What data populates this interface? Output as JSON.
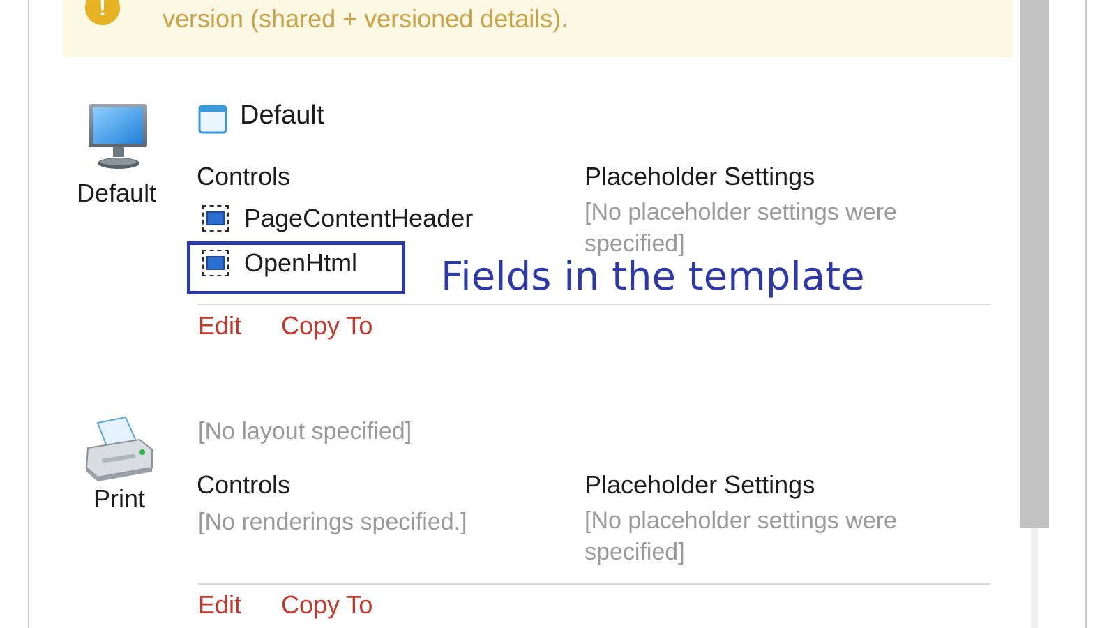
{
  "warning": {
    "icon": "exclamation-icon",
    "icon_glyph": "!",
    "text": "version (shared + versioned details).",
    "background": "#fcf8e3",
    "text_color": "#c8a24a"
  },
  "devices": [
    {
      "name": "Default",
      "icon": "monitor-icon",
      "layout": {
        "icon": "layout-window-icon",
        "name": "Default"
      },
      "controls_heading": "Controls",
      "controls": [
        "PageContentHeader",
        "OpenHtml"
      ],
      "placeholder_heading": "Placeholder Settings",
      "placeholder_text": "[No placeholder settings were specified]",
      "edit_label": "Edit",
      "copy_label": "Copy To"
    },
    {
      "name": "Print",
      "icon": "printer-icon",
      "layout_text": "[No layout specified]",
      "controls_heading": "Controls",
      "controls_empty": "[No renderings specified.]",
      "placeholder_heading": "Placeholder Settings",
      "placeholder_text": "[No placeholder settings were specified]",
      "edit_label": "Edit",
      "copy_label": "Copy To"
    }
  ],
  "annotation": {
    "text": "Fields in the template",
    "color": "#2d39a8"
  },
  "colors": {
    "link": "#c0392b",
    "muted": "#9a9a9a"
  }
}
